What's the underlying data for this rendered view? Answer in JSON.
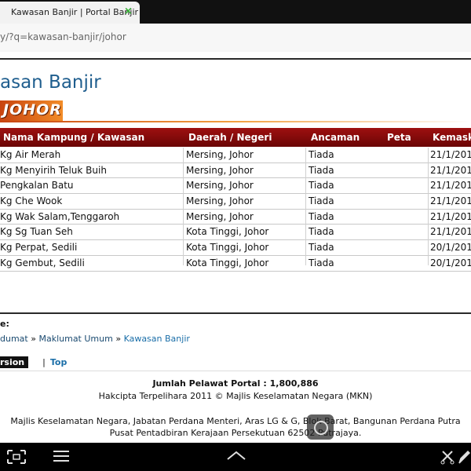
{
  "browser": {
    "tab_title": "Kawasan Banjir | Portal Banjir",
    "tab_close": "×",
    "url": "y/?q=kawasan-banjir/johor"
  },
  "page": {
    "title": "asan Banjir",
    "state": "JOHOR",
    "table": {
      "headers": [
        "Nama Kampung / Kawasan",
        "Daerah / Negeri",
        "Ancaman",
        "Peta",
        "Kemaskin"
      ],
      "rows": [
        [
          "Kg Air Merah",
          "Mersing, Johor",
          "Tiada",
          "",
          "21/1/201"
        ],
        [
          "Kg Menyirih Teluk Buih",
          "Mersing, Johor",
          "Tiada",
          "",
          "21/1/201"
        ],
        [
          "Pengkalan Batu",
          "Mersing, Johor",
          "Tiada",
          "",
          "21/1/201"
        ],
        [
          "Kg Che Wook",
          "Mersing, Johor",
          "Tiada",
          "",
          "21/1/201"
        ],
        [
          "Kg Wak Salam,Tenggaroh",
          "Mersing, Johor",
          "Tiada",
          "",
          "21/1/201"
        ],
        [
          "Kg Sg Tuan Seh",
          "Kota Tinggi, Johor",
          "Tiada",
          "",
          "21/1/201"
        ],
        [
          "Kg Perpat, Sedili",
          "Kota Tinggi, Johor",
          "Tiada",
          "",
          "20/1/201"
        ],
        [
          "Kg Gembut, Sedili",
          "Kota Tinggi, Johor",
          "Tiada",
          "",
          "20/1/201"
        ]
      ]
    },
    "breadcrumb_heading": "e:",
    "breadcrumbs": [
      "dumat",
      "Maklumat Umum",
      "Kawasan Banjir"
    ],
    "breadcrumb_sep": " » ",
    "footer_nav": {
      "version": "rsion",
      "divider": "|",
      "top": "Top"
    },
    "visitors": "Jumlah Pelawat Portal : 1,800,886",
    "copyright": "Hakcipta Terpelihara 2011 © Majlis Keselamatan Negara (MKN)",
    "address_line1": "Majlis Keselamatan Negara, Jabatan Perdana Menteri, Aras LG & G, Blok Barat, Bangunan Perdana Putra",
    "address_line2": "Pusat Pentadbiran Kerajaan Persekutuan 62502 Putrajaya."
  },
  "system_nav": {
    "icons": [
      "screenshot-icon",
      "menu-icon",
      "up-chevron-icon",
      "cut-icon",
      "pen-icon"
    ]
  },
  "colors": {
    "table_header": "#7a0808",
    "title_blue": "#1f5e8e",
    "link_blue": "#1a6ea8",
    "banner_orange": "#e06a1c"
  }
}
